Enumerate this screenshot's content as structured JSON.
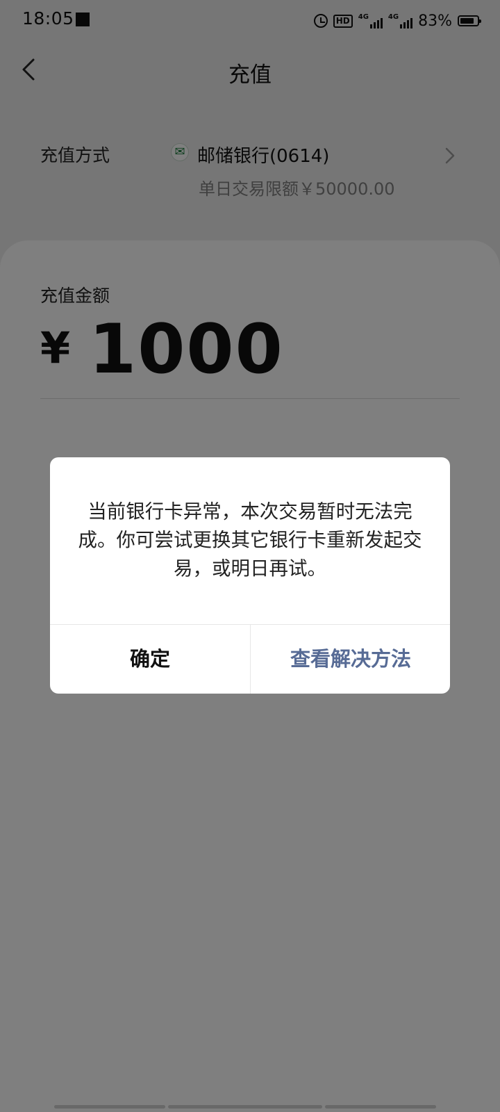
{
  "status_bar": {
    "time": "18:05",
    "hd_label": "HD",
    "network_1": "4G",
    "network_2": "4G",
    "battery_percent": "83%",
    "battery_level": 0.83
  },
  "header": {
    "title": "充值"
  },
  "payment_method": {
    "label": "充值方式",
    "bank_name": "邮储银行(0614)",
    "limit_text": "单日交易限额￥50000.00"
  },
  "amount": {
    "label": "充值金额",
    "currency": "¥",
    "value": "1000"
  },
  "dialog": {
    "message": "当前银行卡异常，本次交易暂时无法完成。你可尝试更换其它银行卡重新发起交易，或明日再试。",
    "confirm_label": "确定",
    "solution_label": "查看解决方法"
  },
  "colors": {
    "link": "#576b95",
    "overlay": "rgba(0,0,0,0.5)",
    "bank_logo_green": "#1a7a3a"
  }
}
